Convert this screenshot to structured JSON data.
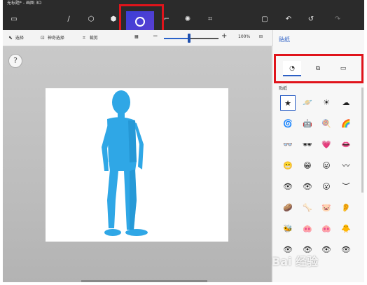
{
  "window": {
    "title": "无标题* - 画图 3D"
  },
  "ribbon": {
    "items": [
      "folder-icon",
      "brush-icon",
      "2d-shapes-icon",
      "3d-objects-icon",
      "stickers-icon",
      "text-icon",
      "effects-icon",
      "canvas-icon",
      "paste-icon",
      "undo-icon",
      "history-icon",
      "redo-icon"
    ]
  },
  "toolbar": {
    "select_label": "选择",
    "magic_select_label": "神奇选择",
    "crop_label": "裁剪",
    "zoom_minus": "−",
    "zoom_plus": "+",
    "zoom_value": "100%",
    "zoom_level_fraction": 0.46
  },
  "canvas": {
    "help_label": "?"
  },
  "panel": {
    "title": "贴纸",
    "section_label": "贴纸",
    "tabs": [
      "stickers-tab",
      "textures-tab",
      "custom-sticker-tab"
    ],
    "stickers": [
      [
        "★",
        "🪐",
        "☀",
        "☁"
      ],
      [
        "🌀",
        "🤖",
        "🍭",
        "🌈"
      ],
      [
        "👓",
        "🕶",
        "💗",
        "👄"
      ],
      [
        "😬",
        "😁",
        "😛",
        "〰"
      ],
      [
        "👁",
        "👁",
        "😮",
        "︶"
      ],
      [
        "🥔",
        "🦴",
        "🐷",
        "👂"
      ],
      [
        "🐝",
        "🐽",
        "🐽",
        "🐥"
      ],
      [
        "👁",
        "👁",
        "👁",
        "👁"
      ]
    ]
  },
  "watermark": "Bai 经验"
}
